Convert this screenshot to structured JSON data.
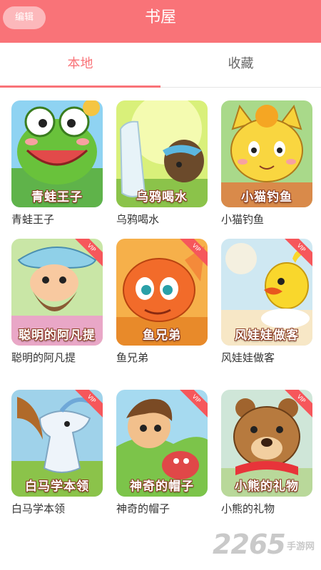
{
  "header": {
    "title": "书屋",
    "edit_label": "编辑",
    "color": "#f97378"
  },
  "tabs": [
    {
      "label": "本地",
      "active": true
    },
    {
      "label": "收藏",
      "active": false
    }
  ],
  "vip_label": "VIP",
  "books": [
    {
      "name": "青蛙王子",
      "cover_title": "青蛙王子",
      "vip": false
    },
    {
      "name": "乌鸦喝水",
      "cover_title": "乌鸦喝水",
      "vip": false
    },
    {
      "name": "小猫钓鱼",
      "cover_title": "小猫钓鱼",
      "vip": false
    },
    {
      "name": "聪明的阿凡提",
      "cover_title": "聪明的阿凡提",
      "vip": true
    },
    {
      "name": "鱼兄弟",
      "cover_title": "鱼兄弟",
      "vip": true
    },
    {
      "name": "风娃娃做客",
      "cover_title": "风娃娃做客",
      "vip": true
    },
    {
      "name": "白马学本领",
      "cover_title": "白马学本领",
      "vip": true
    },
    {
      "name": "神奇的帽子",
      "cover_title": "神奇的帽子",
      "vip": true
    },
    {
      "name": "小熊的礼物",
      "cover_title": "小熊的礼物",
      "vip": true
    }
  ],
  "watermark": {
    "number": "2265",
    "text": "手游网"
  }
}
